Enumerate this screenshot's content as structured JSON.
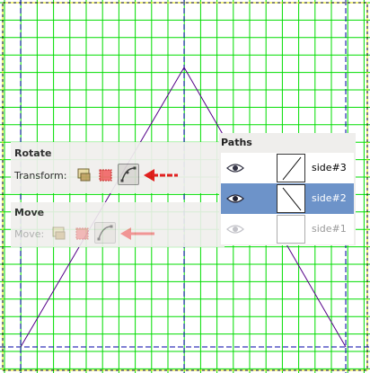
{
  "rotate_panel": {
    "title": "Rotate",
    "transform_label": "Transform:"
  },
  "move_panel": {
    "title": "Move",
    "move_label": "Move:"
  },
  "paths_panel": {
    "title": "Paths",
    "paths": [
      {
        "name": "side#3",
        "visible": true,
        "selected": false
      },
      {
        "name": "side#2",
        "visible": true,
        "selected": true
      },
      {
        "name": "side#1",
        "visible": false,
        "selected": false
      }
    ]
  },
  "icons": {
    "transform_layer": "layer-transform-icon",
    "transform_selection": "selection-transform-icon",
    "transform_path": "path-transform-icon",
    "arrow": "left-arrow-icon",
    "eye": "eye-icon"
  },
  "colors": {
    "grid": "#00dd00",
    "guide": "#0000aa",
    "path": "#550088",
    "arrow_strong": "#e01010",
    "arrow_faded": "#f08a8a",
    "selected_row": "#6d93c9"
  }
}
